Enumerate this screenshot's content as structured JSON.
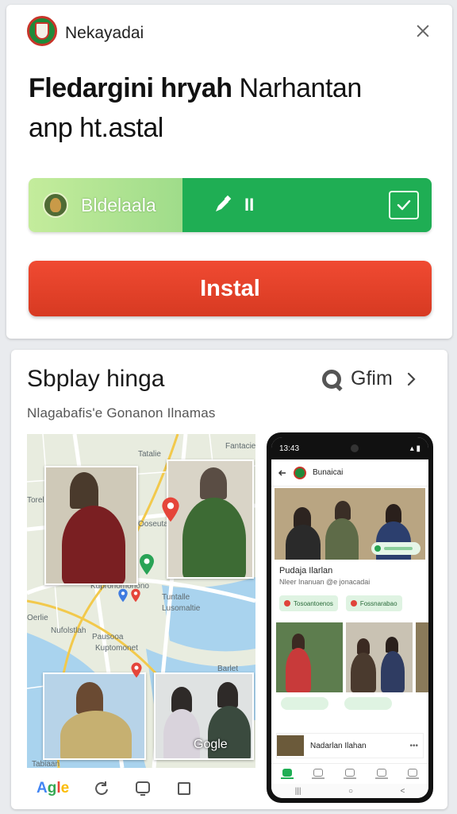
{
  "top_card": {
    "app_name": "Nekayadai",
    "headline_bold": "Fledargini hryah",
    "headline_rest": " Narhantan",
    "headline_line2": "anp ht.astal",
    "progress": {
      "label": "Bldelaala",
      "tool_text": "II"
    },
    "install_button": "Instal"
  },
  "bottom_card": {
    "title": "Sbplay hinga",
    "link_text": "Gfim",
    "subtitle": "Nlagabafis'e Gonanon Ilnamas",
    "map": {
      "labels": [
        "Tatalie",
        "Fantacie",
        "Torel",
        "Ooseuta",
        "Kupronomonono",
        "Tuntalle",
        "Lusomaltie",
        "Oerlie",
        "Nufolstlah",
        "Pausooa",
        "Kuptomonet",
        "Barlet",
        "Tabiaan"
      ],
      "google_text": "Gogle"
    },
    "browser_bar": {
      "logo": [
        "A",
        "g",
        "l",
        "e"
      ]
    },
    "phone": {
      "time": "13:43",
      "header_title": "Bunaicai",
      "post_title": "Pudaja Ilarlan",
      "post_sub": "Nleer Inanuan @e jonacadai",
      "chips": [
        "Tosoantoenos",
        "Fossnarabao"
      ],
      "list_item": "Nadarlan Ilahan",
      "list_more": "•••",
      "sysnav": [
        "|||",
        "○",
        "<"
      ]
    }
  },
  "colors": {
    "install_red": "#e2432b",
    "progress_green": "#1fae54",
    "progress_light": "#b8e795"
  }
}
